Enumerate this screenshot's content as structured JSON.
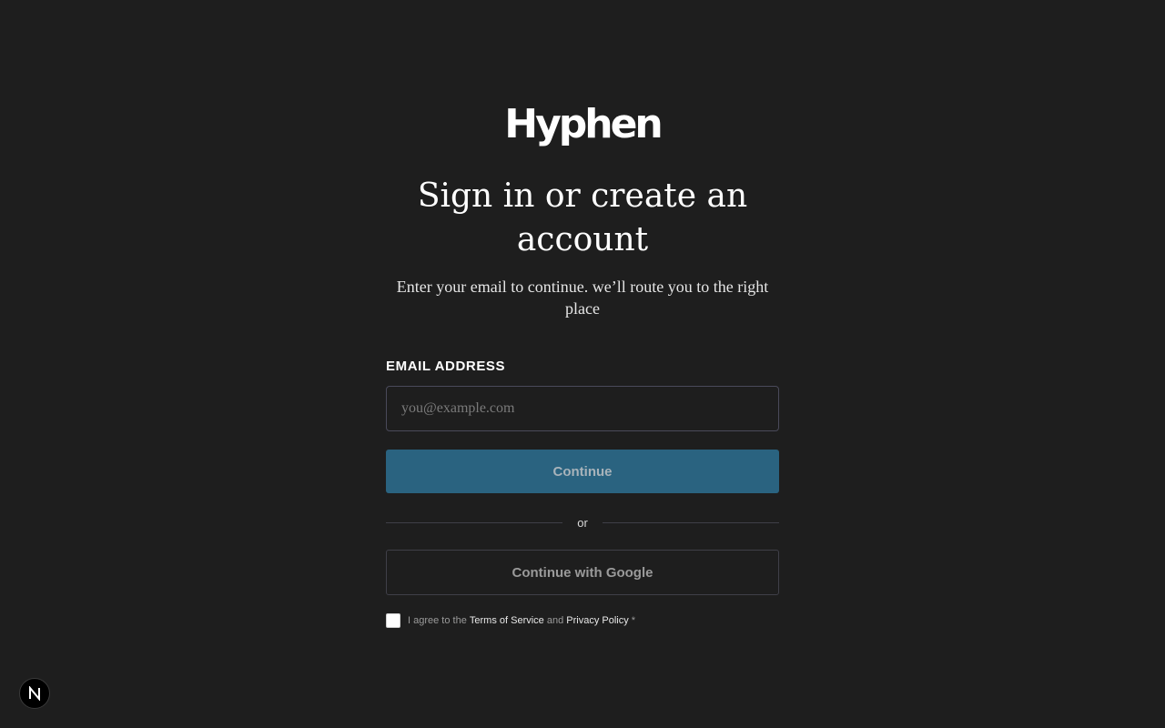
{
  "brand": {
    "logo_text": "Hyphen"
  },
  "header": {
    "title": "Sign in or create an account",
    "subtitle": "Enter your email to continue. we’ll route you to the right place"
  },
  "form": {
    "email_label": "EMAIL ADDRESS",
    "email_value": "",
    "email_placeholder": "you@example.com",
    "continue_label": "Continue",
    "divider_text": "or",
    "google_label": "Continue with Google"
  },
  "agreement": {
    "checked": false,
    "prefix": "I agree to the ",
    "terms_label": "Terms of Service",
    "middle": " and ",
    "privacy_label": "Privacy Policy",
    "required_mark": " *"
  },
  "dev_badge": {
    "icon": "n-logo-icon"
  },
  "colors": {
    "background": "#1e1e1e",
    "primary_button": "#2a6380",
    "border": "#3f3f48"
  }
}
